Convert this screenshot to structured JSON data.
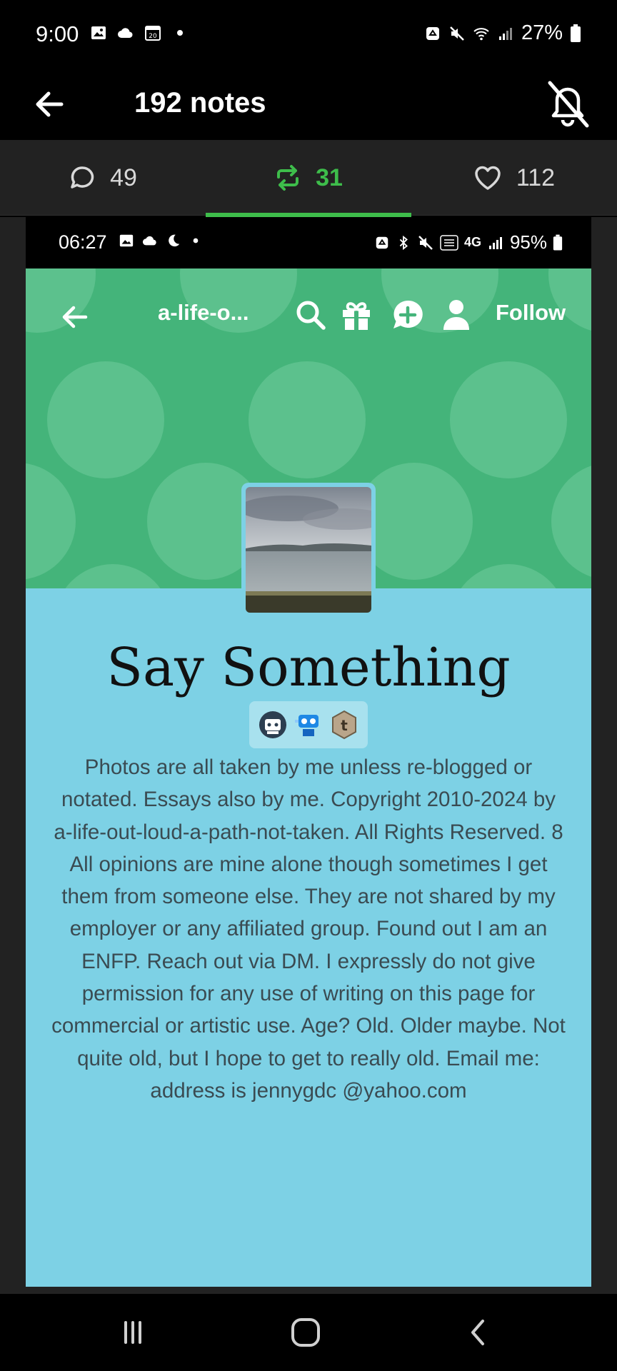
{
  "status_bar": {
    "time": "9:00",
    "battery": "27%",
    "left_icons": [
      "gallery-icon",
      "cloud-icon",
      "calendar-icon",
      "dot-icon"
    ],
    "right_icons": [
      "recycle-icon",
      "mute-icon",
      "wifi-icon",
      "signal-icon",
      "battery-icon"
    ]
  },
  "header": {
    "title": "192 notes",
    "back_icon": "arrow-left-icon",
    "mute_icon": "notifications-off-icon"
  },
  "tabs": [
    {
      "icon": "comment-icon",
      "count": "49"
    },
    {
      "icon": "reblog-icon",
      "count": "31",
      "active": true
    },
    {
      "icon": "heart-icon",
      "count": "112"
    }
  ],
  "colors": {
    "accent": "#3ebd4b",
    "banner": "#44b47a",
    "blog_bg": "#7dd1e5"
  },
  "embedded": {
    "status_bar": {
      "time": "06:27",
      "battery": "95%",
      "network": "4G"
    },
    "nav": {
      "blog_name": "a-life-o...",
      "follow_label": "Follow",
      "icons": [
        "back-icon",
        "search-icon",
        "gift-icon",
        "message-plus-icon",
        "user-icon"
      ]
    },
    "blog_title": "Say Something",
    "badges": [
      "robot-badge-icon",
      "tape-badge-icon",
      "tumblr-badge-icon"
    ],
    "description": "Photos are all taken by me unless re-blogged or notated. Essays also by me. Copyright 2010-2024 by a-life-out-loud-a-path-not-taken. All Rights Reserved. 8 All opinions are mine alone though sometimes I get them from someone else. They are not shared by my employer or any affiliated group. Found out I am an ENFP. Reach out via DM. I expressly do not give permission for any use of writing on this page for commercial or artistic use. Age? Old. Older maybe. Not quite old, but I hope to get to really old. Email me: address is jennygdc @yahoo.com"
  },
  "navbar": {
    "icons": [
      "recents-icon",
      "home-icon",
      "back-icon"
    ]
  }
}
